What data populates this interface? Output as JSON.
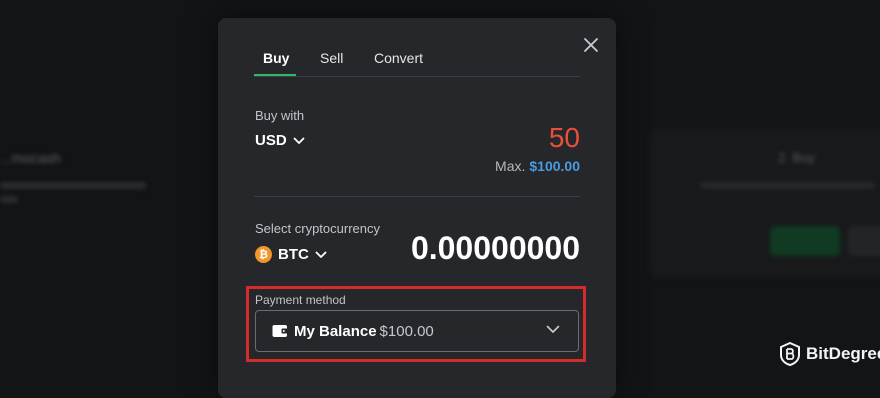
{
  "background": {
    "left_title": "...mocash",
    "right_title": "2. Buy"
  },
  "modal": {
    "tabs": [
      {
        "label": "Buy",
        "active": true
      },
      {
        "label": "Sell",
        "active": false
      },
      {
        "label": "Convert",
        "active": false
      }
    ],
    "buy_with": {
      "label": "Buy with",
      "currency": "USD",
      "amount": "50",
      "max_label": "Max.",
      "max_amount": "$100.00"
    },
    "crypto": {
      "label": "Select cryptocurrency",
      "coin_symbol": "₿",
      "currency": "BTC",
      "amount": "0.00000000"
    },
    "payment": {
      "label": "Payment method",
      "method": "My Balance",
      "balance": "$100.00"
    }
  },
  "watermark": {
    "brand": "BitDegree"
  },
  "colors": {
    "accent_green": "#2fb865",
    "amount_red": "#e8503a",
    "link_blue": "#4a9ce0",
    "highlight_red": "#d42b2b",
    "btc_orange": "#f0962a"
  },
  "icons": [
    "close-icon",
    "chevron-down-icon",
    "btc-icon",
    "wallet-icon",
    "bitdegree-logo-icon"
  ]
}
